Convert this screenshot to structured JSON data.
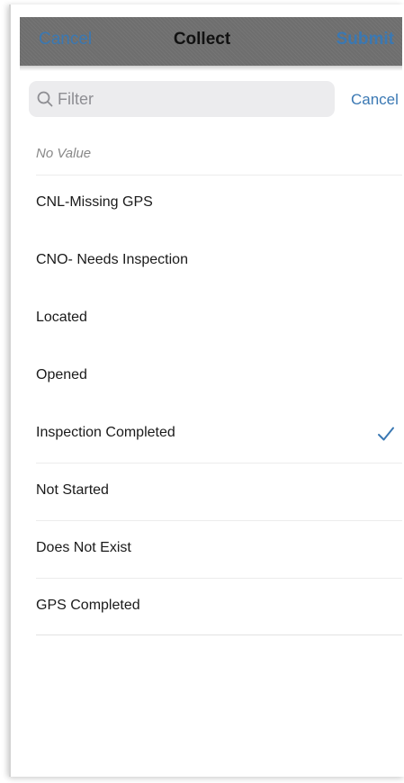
{
  "navbar": {
    "cancel_label": "Cancel",
    "title": "Collect",
    "submit_label": "Submit"
  },
  "search": {
    "placeholder": "Filter",
    "icon": "search-icon",
    "cancel_label": "Cancel"
  },
  "options": {
    "no_value": "No Value",
    "items": [
      {
        "label": "CNL-Missing GPS",
        "selected": false
      },
      {
        "label": "CNO- Needs Inspection",
        "selected": false
      },
      {
        "label": "Located",
        "selected": false
      },
      {
        "label": "Opened",
        "selected": false
      },
      {
        "label": "Inspection Completed",
        "selected": true
      },
      {
        "label": "Not Started",
        "selected": false
      },
      {
        "label": "Does Not Exist",
        "selected": false
      },
      {
        "label": "GPS Completed",
        "selected": false
      }
    ]
  },
  "colors": {
    "accent": "#3a78b3",
    "navbar_bg": "#6e6e6e",
    "search_bg": "#ececee"
  }
}
